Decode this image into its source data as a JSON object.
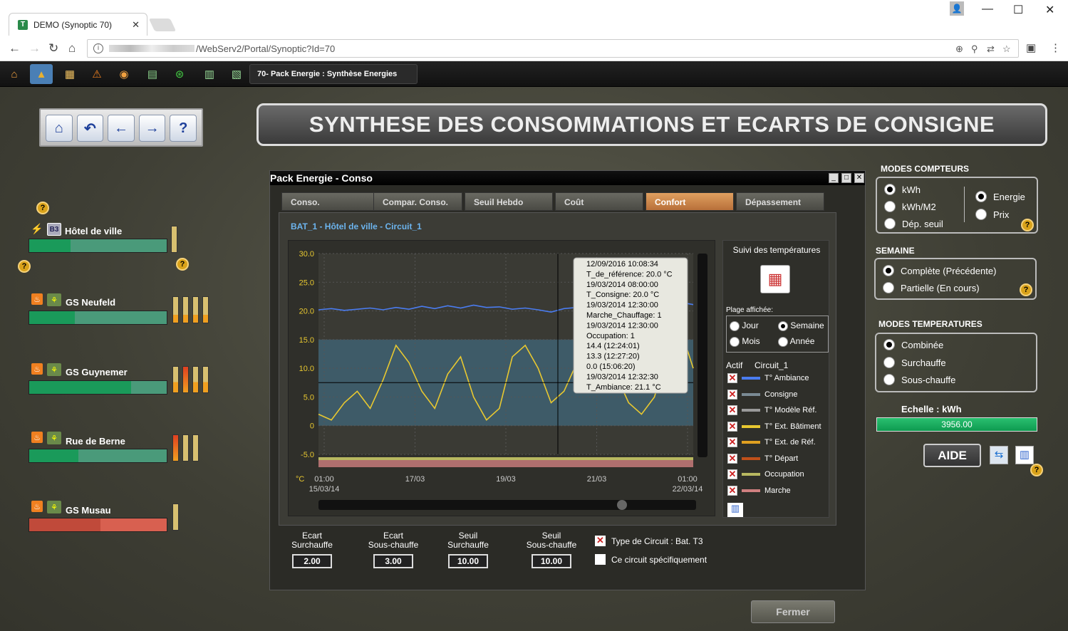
{
  "browser": {
    "tab_title": "DEMO (Synoptic 70)",
    "url": "/WebServ2/Portal/Synoptic?Id=70"
  },
  "toolbar": {
    "title": "70- Pack Energie : Synthèse Energies"
  },
  "page": {
    "title": "SYNTHESE DES CONSOMMATIONS ET ECARTS DE CONSIGNE"
  },
  "buildings": [
    {
      "badge": "B3",
      "name": "Hôtel de ville",
      "bar_fraction": 0.3,
      "bar_color": "#1a9a5a"
    },
    {
      "name": "GS Neufeld",
      "bar_fraction": 0.33,
      "bar_color": "#1a9a5a"
    },
    {
      "name": "GS Guynemer",
      "bar_fraction": 0.74,
      "bar_color": "#1a9a5a"
    },
    {
      "name": "Rue de Berne",
      "bar_fraction": 0.36,
      "bar_color": "#1a9a5a"
    },
    {
      "name": "GS Musau",
      "bar_fraction": 0.52,
      "bar_color": "#c04a3a"
    }
  ],
  "window": {
    "title": "Pack Energie - Conso",
    "tabs": [
      "Conso.",
      "Compar. Conso.",
      "Seuil Hebdo",
      "Coût",
      "Confort",
      "Dépassement"
    ],
    "active_tab": "Confort",
    "circuit_label": "BAT_1 - Hôtel de ville - Circuit_1",
    "fermer": "Fermer"
  },
  "chart_data": {
    "type": "line",
    "y_ticks": [
      "30.0",
      "25.0",
      "20.0",
      "15.0",
      "10.0",
      "5.0",
      "0",
      "-5.0"
    ],
    "y_unit": "°C",
    "x_ticks": [
      {
        "line1": "01:00",
        "line2": "15/03/14"
      },
      {
        "line1": "17/03",
        "line2": ""
      },
      {
        "line1": "19/03",
        "line2": ""
      },
      {
        "line1": "21/03",
        "line2": ""
      },
      {
        "line1": "01:00",
        "line2": "22/03/14"
      }
    ],
    "ylim": [
      -5,
      30
    ],
    "series": [
      {
        "name": "T° Ambiance",
        "color": "#4a7cf0",
        "values": [
          20.2,
          20.4,
          20.1,
          20.3,
          20.5,
          20.2,
          20.6,
          20.3,
          20.8,
          20.4,
          20.9,
          20.5,
          21.0,
          20.6,
          20.7,
          20.3,
          20.5,
          20.2,
          19.8,
          20.4,
          20.6,
          20.9,
          21.1,
          20.5,
          21.2,
          20.8,
          21.3,
          21.0,
          21.5,
          21.1
        ]
      },
      {
        "name": "T° Ext. Bâtiment",
        "color": "#e8c830",
        "values": [
          2,
          1,
          4,
          6,
          3,
          8,
          14,
          11,
          6,
          3,
          9,
          12,
          5,
          1,
          3,
          12,
          14,
          10,
          4,
          6,
          11,
          17,
          14,
          9,
          4,
          2,
          5,
          13,
          17,
          10
        ]
      }
    ],
    "tooltip": [
      "12/09/2016 10:08:34",
      "T_de_référence: 20.0 °C",
      "19/03/2014 08:00:00",
      "T_Consigne: 20.0 °C",
      "19/03/2014 12:30:00",
      "Marche_Chauffage: 1",
      "19/03/2014 12:30:00",
      "Occupation: 1",
      "14.4 (12:24:01)",
      "13.3 (12:27:20)",
      "0.0 (15:06:20)",
      "19/03/2014 12:32:30",
      "T_Ambiance: 21.1 °C"
    ]
  },
  "side": {
    "suivi": "Suivi des températures",
    "plage": "Plage affichée:",
    "jour": "Jour",
    "semaine": "Semaine",
    "mois": "Mois",
    "annee": "Année",
    "actif": "Actif",
    "circuit": "Circuit_1",
    "legend": [
      {
        "label": "T° Ambiance",
        "color": "#4a7cf0"
      },
      {
        "label": "Consigne",
        "color": "#7a8a94"
      },
      {
        "label": "T° Modèle Réf.",
        "color": "#9a9a9a"
      },
      {
        "label": "T° Ext. Bâtiment",
        "color": "#e8c830"
      },
      {
        "label": "T° Ext. de Réf.",
        "color": "#e0a020"
      },
      {
        "label": "T° Départ",
        "color": "#c0501a"
      },
      {
        "label": "Occupation",
        "color": "#b8b860"
      },
      {
        "label": "Marche",
        "color": "#d08080"
      }
    ]
  },
  "params": [
    {
      "l1": "Ecart",
      "l2": "Surchauffe",
      "value": "2.00"
    },
    {
      "l1": "Ecart",
      "l2": "Sous-chauffe",
      "value": "3.00"
    },
    {
      "l1": "Seuil",
      "l2": "Surchauffe",
      "value": "10.00"
    },
    {
      "l1": "Seuil",
      "l2": "Sous-chauffe",
      "value": "10.00"
    }
  ],
  "checks": {
    "type_circuit": "Type de Circuit : Bat. T3",
    "ce_circuit": "Ce circuit spécifiquement"
  },
  "right": {
    "modes_compteurs": "MODES COMPTEURS",
    "kwh": "kWh",
    "kwh_m2": "kWh/M2",
    "dep_seuil": "Dép. seuil",
    "energie": "Energie",
    "prix": "Prix",
    "semaine": "SEMAINE",
    "complete": "Complète (Précédente)",
    "partielle": "Partielle (En cours)",
    "modes_temp": "MODES TEMPERATURES",
    "combinee": "Combinée",
    "surchauffe": "Surchauffe",
    "souschauffe": "Sous-chauffe",
    "echelle": "Echelle : kWh",
    "echelle_value": "3956.00",
    "aide": "AIDE"
  }
}
